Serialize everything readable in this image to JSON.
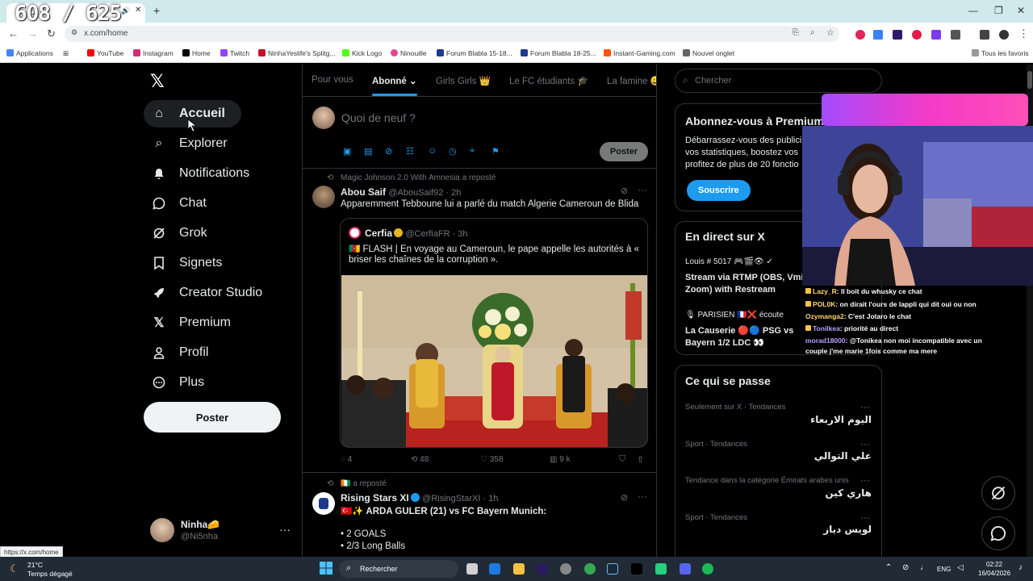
{
  "overlay": {
    "counter": "608 / 625"
  },
  "browser": {
    "url": "x.com/home",
    "bookmarks": [
      {
        "label": "Applications",
        "color": "#4285f4"
      },
      {
        "label": "YouTube",
        "color": "#ff0000"
      },
      {
        "label": "Instagram",
        "color": "#d62976"
      },
      {
        "label": "Home",
        "color": "#000000"
      },
      {
        "label": "Twitch",
        "color": "#9146ff"
      },
      {
        "label": "NinhaYeslife's Splitg...",
        "color": "#c8102e"
      },
      {
        "label": "Kick Logo",
        "color": "#53fc18"
      },
      {
        "label": "Ninouille",
        "color": "#e84393"
      },
      {
        "label": "Forum Blabla 15-18...",
        "color": "#1e3a8a"
      },
      {
        "label": "Forum Blabla 18-25...",
        "color": "#1e3a8a"
      },
      {
        "label": "Instant-Gaming.com",
        "color": "#ff5400"
      },
      {
        "label": "Nouvel onglet",
        "color": "#666666"
      }
    ],
    "all_bookmarks": "Tous les favoris",
    "status_url": "https://x.com/home"
  },
  "sidebar": {
    "logo": "𝕏",
    "items": [
      {
        "label": "Accueil",
        "icon": "home-icon",
        "glyph": "⌂"
      },
      {
        "label": "Explorer",
        "icon": "search-icon",
        "glyph": "⌕"
      },
      {
        "label": "Notifications",
        "icon": "bell-icon",
        "glyph": "♪"
      },
      {
        "label": "Chat",
        "icon": "chat-icon",
        "glyph": "◯"
      },
      {
        "label": "Grok",
        "icon": "grok-icon",
        "glyph": "⊘"
      },
      {
        "label": "Signets",
        "icon": "bookmark-icon",
        "glyph": "⛉"
      },
      {
        "label": "Creator Studio",
        "icon": "rocket-icon",
        "glyph": "➶"
      },
      {
        "label": "Premium",
        "icon": "x-icon",
        "glyph": "X"
      },
      {
        "label": "Profil",
        "icon": "person-icon",
        "glyph": "♙"
      },
      {
        "label": "Plus",
        "icon": "more-icon",
        "glyph": "⋯"
      }
    ],
    "post_label": "Poster",
    "profile": {
      "name": "Ninha🧀",
      "handle": "@Ni5nha",
      "more": "···"
    }
  },
  "feed": {
    "tabs": [
      "Pour vous",
      "Abonné ⌄",
      "Girls Girls 👑",
      "Le FC étudiants 🎓",
      "La famine 😀"
    ],
    "composer_placeholder": "Quoi de neuf ?",
    "composer_post": "Poster",
    "tweets": [
      {
        "repost_line": "Magic Johnson 2.0 With Amnesia a reposté",
        "name": "Abou Saif",
        "handle": "@AbouSaif92 · 2h",
        "text": "Apparemment Tebboune lui a parlé du match Algerie Cameroun de Blida",
        "quote": {
          "name": "Cerfia",
          "handle": "@CerfiaFR · 3h",
          "text_1": "🇨🇲 FLASH | En voyage au Cameroun, le pape appelle les autorités à «",
          "text_2": "briser les chaînes de la corruption »."
        },
        "stats": {
          "replies": "4",
          "reposts": "48",
          "likes": "358",
          "views": "9 k"
        }
      },
      {
        "repost_line": "🇨🇮 a reposté",
        "name": "Rising Stars XI",
        "handle": "@RisingStarXI · 1h",
        "text": "🇹🇷✨ ARDA GULER (21) vs FC Bayern Munich:",
        "bullets": [
          "• 2 GOALS",
          "• 2/3 Long Balls"
        ]
      }
    ]
  },
  "right": {
    "search_placeholder": "Chercher",
    "premium": {
      "title": "Abonnez-vous à Premium",
      "desc_1": "Débarrassez-vous des publici",
      "desc_2": "vos statistiques, boostez vos",
      "desc_3": "profitez de plus de 20 fonctio",
      "button": "Souscrire"
    },
    "live": {
      "title": "En direct sur X",
      "item1_user": "Louis # 5017 🎮🎬👁 ✓",
      "item1_title_1": "Stream via RTMP (OBS, Vmix,",
      "item1_title_2": "Zoom) with Restream",
      "item2_user": "🎙 PARISIEN 🇫🇷❌ écoute",
      "item2_title_1": "La Causerie 🔴🔵 PSG vs",
      "item2_title_2": "Bayern 1/2 LDC 👀"
    },
    "trends": {
      "title": "Ce qui se passe",
      "items": [
        {
          "context": "Seulement sur X · Tendances",
          "name": "اليوم الاربعاء"
        },
        {
          "context": "Sport · Tendances",
          "name": "علي التوالي"
        },
        {
          "context": "Tendance dans la catégorie Émirats arabes unis",
          "name": "هاري كين"
        },
        {
          "context": "Sport · Tendances",
          "name": "لويس دياز"
        }
      ],
      "more": "···"
    }
  },
  "chat": [
    {
      "user": "Lazy_R",
      "msg": ": Il boit du whusky ce chat"
    },
    {
      "user": "POL0K",
      "msg": ": on dirait l'ours de lappli qui dit oui ou non"
    },
    {
      "user": "Ozymanga2",
      "msg": ": C'est Jotaro le chat"
    },
    {
      "user": "Tonilkea",
      "msg": ": priorité au direct"
    },
    {
      "user": "morad18000",
      "msg": ": @Tonikea non moi incompatible avec un"
    },
    {
      "user": "",
      "msg": "couple j'me marie 1fois comme ma mere"
    }
  ],
  "taskbar": {
    "temp": "21°C",
    "weather": "Temps dégagé",
    "search": "Rechercher",
    "lang": "ENG",
    "time": "02:22",
    "date": "16/04/2026"
  }
}
